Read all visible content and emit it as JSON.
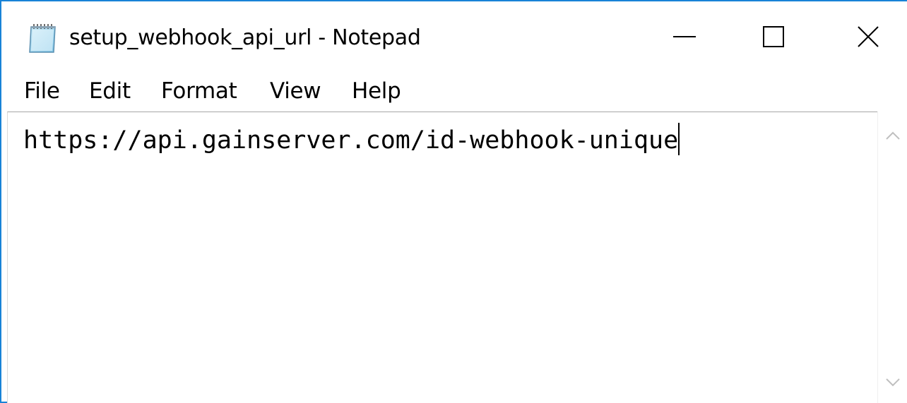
{
  "window": {
    "title": "setup_webhook_api_url - Notepad",
    "app_icon": "notepad-icon",
    "controls": {
      "minimize_icon": "minimize-icon",
      "maximize_icon": "maximize-icon",
      "close_icon": "close-icon"
    },
    "accent_color": "#1883d7"
  },
  "menu": {
    "items": [
      {
        "label": "File"
      },
      {
        "label": "Edit"
      },
      {
        "label": "Format"
      },
      {
        "label": "View"
      },
      {
        "label": "Help"
      }
    ]
  },
  "editor": {
    "content": "https://api.gainserver.com/id-webhook-unique"
  },
  "scrollbar": {
    "up_icon": "chevron-up-icon",
    "down_icon": "chevron-down-icon"
  }
}
